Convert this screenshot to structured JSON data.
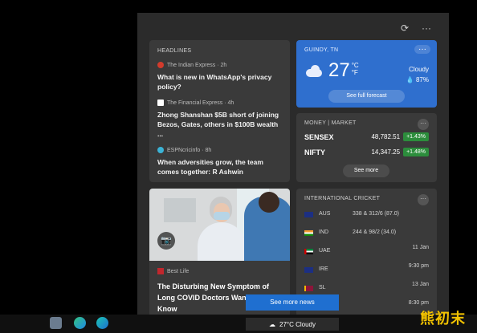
{
  "panel": {
    "refresh_icon": "refresh-icon",
    "more_icon": "more-icon"
  },
  "headlines": {
    "header": "HEADLINES",
    "items": [
      {
        "source": "The Indian Express · 2h",
        "title": "What is new in WhatsApp's privacy policy?",
        "color": "#d23b2c"
      },
      {
        "source": "The Financial Express · 4h",
        "title": "Zhong Shanshan $5B short of joining Bezos, Gates, others in $100B wealth ...",
        "color": "#ffffff"
      },
      {
        "source": "ESPNcricinfo · 8h",
        "title": "When adversities grow, the team comes together: R Ashwin",
        "color": "#3bb3d6"
      }
    ]
  },
  "weather": {
    "location": "GUINDY, TN",
    "temperature": "27",
    "unit_c": "°C",
    "unit_f": "°F",
    "condition": "Cloudy",
    "humidity": "87%",
    "button": "See full forecast"
  },
  "money": {
    "header": "MONEY | MARKET",
    "rows": [
      {
        "name": "SENSEX",
        "value": "48,782.51",
        "change": "+1.43%"
      },
      {
        "name": "NIFTY",
        "value": "14,347.25",
        "change": "+1.48%"
      }
    ],
    "button": "See more"
  },
  "story": {
    "source": "Best Life",
    "title": "The Disturbing New Symptom of Long COVID Doctors Want You to Know"
  },
  "cricket": {
    "header": "INTERNATIONAL CRICKET",
    "rows": [
      {
        "team": "AUS",
        "score": "338 & 312/6 (87.0)",
        "date_l1": "",
        "date_l2": ""
      },
      {
        "team": "IND",
        "score": "244 & 98/2 (34.0)",
        "date_l1": "",
        "date_l2": ""
      },
      {
        "team": "UAE",
        "score": "",
        "date_l1": "11 Jan",
        "date_l2": ""
      },
      {
        "team": "IRE",
        "score": "",
        "date_l1": "9:30 pm",
        "date_l2": ""
      },
      {
        "team": "SL",
        "score": "",
        "date_l1": "13 Jan",
        "date_l2": ""
      },
      {
        "team": "",
        "score": "",
        "date_l1": "8:30 pm",
        "date_l2": ""
      }
    ]
  },
  "see_more_news": "See more news",
  "taskbar": {
    "weather": "27°C  Cloudy"
  },
  "watermark": "熊初末"
}
